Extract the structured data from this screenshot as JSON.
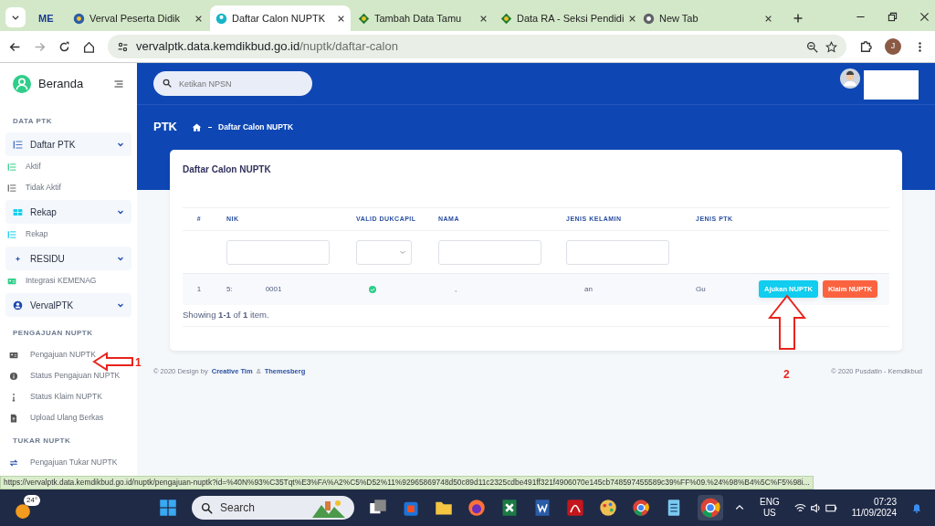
{
  "browser": {
    "tabs": [
      {
        "title": "ME",
        "selected": false
      },
      {
        "title": "Verval Peserta Didik",
        "selected": false
      },
      {
        "title": "Daftar Calon NUPTK",
        "selected": true
      },
      {
        "title": "Tambah Data Tamu",
        "selected": false
      },
      {
        "title": "Data RA - Seksi Pendidi",
        "selected": false
      },
      {
        "title": "New Tab",
        "selected": false
      }
    ],
    "address": {
      "host": "vervalptk.data.kemdikbud.go.id",
      "path": "/nuptk/daftar-calon"
    },
    "profile": "J"
  },
  "sidebar": {
    "brand": "Beranda",
    "sections": [
      {
        "heading": "DATA PTK",
        "items": [
          {
            "label": "Daftar PTK",
            "kind": "group",
            "children": [
              {
                "label": "Aktif",
                "kind": "link"
              },
              {
                "label": "Tidak Aktif",
                "kind": "link"
              }
            ]
          },
          {
            "label": "Rekap",
            "kind": "group",
            "children": [
              {
                "label": "Rekap",
                "kind": "link"
              }
            ]
          },
          {
            "label": "RESIDU",
            "kind": "group",
            "children": [
              {
                "label": "Integrasi KEMENAG",
                "kind": "link"
              }
            ]
          },
          {
            "label": "VervalPTK",
            "kind": "group"
          }
        ]
      },
      {
        "heading": "PENGAJUAN NUPTK",
        "items": [
          {
            "label": "Pengajuan NUPTK",
            "kind": "link"
          },
          {
            "label": "Status Pengajuan NUPTK",
            "kind": "link"
          },
          {
            "label": "Status Klaim NUPTK",
            "kind": "link"
          },
          {
            "label": "Upload Ulang Berkas",
            "kind": "link"
          }
        ]
      },
      {
        "heading": "TUKAR NUPTK",
        "items": [
          {
            "label": "Pengajuan Tukar NUPTK",
            "kind": "link"
          }
        ]
      }
    ]
  },
  "topbar": {
    "search": {
      "placeholder": "Ketikan NPSN"
    }
  },
  "header": {
    "title": "PTK",
    "breadcrumb": "Daftar Calon NUPTK"
  },
  "card": {
    "title": "Daftar Calon NUPTK",
    "table": {
      "columns": [
        {
          "label": "#"
        },
        {
          "label": "NIK",
          "filter": {
            "kind": "text"
          }
        },
        {
          "label": "VALID DUKCAPIL",
          "filter": {
            "kind": "select"
          }
        },
        {
          "label": "NAMA",
          "filter": {
            "kind": "text"
          }
        },
        {
          "label": "JENIS KELAMIN",
          "filter": {
            "kind": "text"
          }
        },
        {
          "label": "JENIS PTK"
        }
      ],
      "rows": [
        {
          "number": "1",
          "nik": [
            "5:",
            "0001"
          ],
          "valid_dukcapil": true,
          "nama": ",",
          "jenis_kelamin": "an",
          "jenis_ptk": "Gu",
          "actions": [
            {
              "label": "Ajukan NUPTK",
              "color": "#11cdef"
            },
            {
              "label": "Klaim NUPTK",
              "color": "#fb6340"
            }
          ]
        }
      ]
    },
    "summary": "Showing **1-1** of **1** item."
  },
  "footer": {
    "left": "© 2020 Design by",
    "links": [
      "Creative Tim",
      "Themesberg"
    ],
    "separator": "&",
    "right": "© 2020 Pusdatin - Kemdikbud"
  },
  "annotations": [
    {
      "label": "1",
      "kind": "left"
    },
    {
      "label": "2",
      "kind": "up"
    }
  ],
  "status_url": "https://vervalptk.data.kemdikbud.go.id/nuptk/pengajuan-nuptk?id=%40N%93%C35Tqt%E3%FA%A2%C5%D52%11%92965869748d50c89d11c2325cdbe491ff321f4906070e145cb748597455589c39%FF%09.%24%98%B4%5C%F5%98i...",
  "taskbar": {
    "weather": "24°",
    "search": "Search",
    "language": [
      "ENG",
      "US"
    ],
    "time": "07:23",
    "date": "11/09/2024"
  }
}
